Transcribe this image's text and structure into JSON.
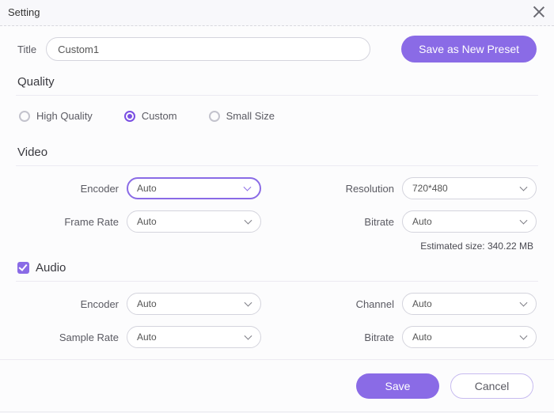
{
  "dialog": {
    "title": "Setting"
  },
  "title_row": {
    "label": "Title",
    "value": "Custom1",
    "preset_button": "Save as New Preset"
  },
  "quality": {
    "heading": "Quality",
    "options": [
      "High Quality",
      "Custom",
      "Small Size"
    ],
    "selected_index": 1
  },
  "video": {
    "heading": "Video",
    "encoder": {
      "label": "Encoder",
      "value": "Auto"
    },
    "resolution": {
      "label": "Resolution",
      "value": "720*480"
    },
    "frame_rate": {
      "label": "Frame Rate",
      "value": "Auto"
    },
    "bitrate": {
      "label": "Bitrate",
      "value": "Auto"
    },
    "estimated": "Estimated size: 340.22 MB"
  },
  "audio": {
    "heading": "Audio",
    "enabled": true,
    "encoder": {
      "label": "Encoder",
      "value": "Auto"
    },
    "channel": {
      "label": "Channel",
      "value": "Auto"
    },
    "sample_rate": {
      "label": "Sample Rate",
      "value": "Auto"
    },
    "bitrate": {
      "label": "Bitrate",
      "value": "Auto"
    }
  },
  "footer": {
    "save": "Save",
    "cancel": "Cancel"
  }
}
